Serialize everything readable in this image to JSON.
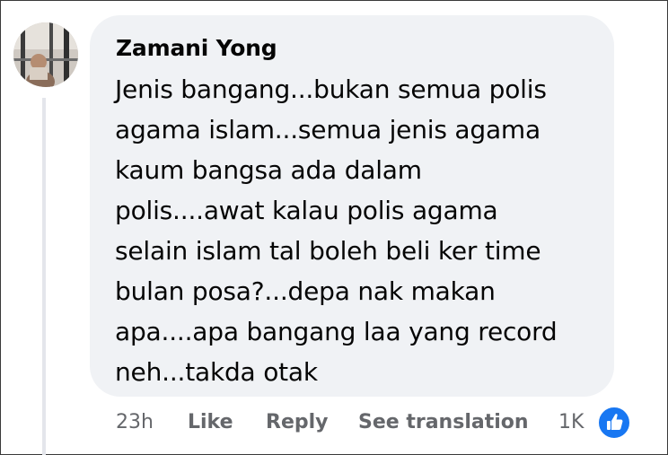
{
  "comment": {
    "author": "Zamani Yong",
    "lines": [
      "Jenis bangang...bukan semua polis",
      "agama islam...semua jenis agama",
      "kaum bangsa ada dalam",
      "polis....awat kalau polis agama",
      "selain islam tal boleh beli ker time",
      "bulan posa?...depa nak makan",
      "apa....apa bangang laa yang record",
      "neh...takda otak"
    ]
  },
  "actions": {
    "time": "23h",
    "like": "Like",
    "reply": "Reply",
    "translate": "See translation"
  },
  "reactions": {
    "count": "1K",
    "icon": "thumbs-up-icon",
    "color": "#1877f2"
  },
  "colors": {
    "bubble": "#f0f2f5",
    "text": "#050505",
    "secondary_text": "#65676b"
  }
}
